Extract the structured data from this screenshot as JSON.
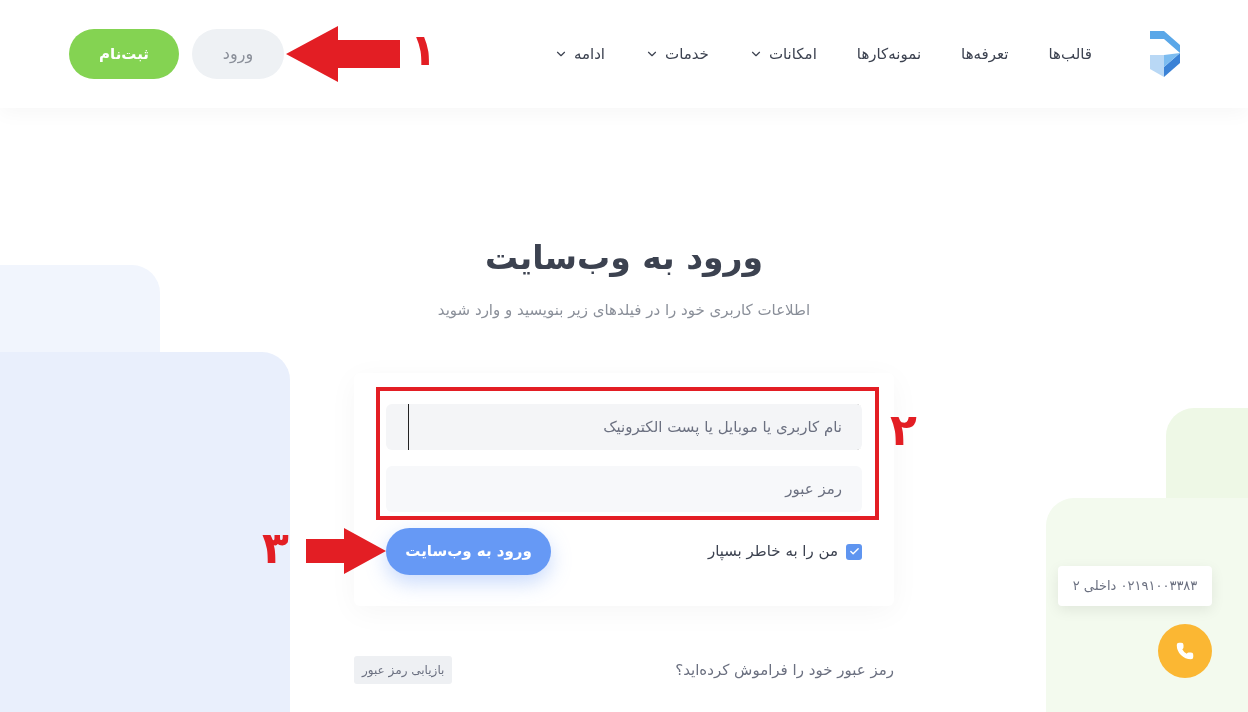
{
  "header": {
    "nav": [
      {
        "label": "قالب‌ها",
        "has_dropdown": false
      },
      {
        "label": "تعرفه‌ها",
        "has_dropdown": false
      },
      {
        "label": "نمونه‌کارها",
        "has_dropdown": false
      },
      {
        "label": "امکانات",
        "has_dropdown": true
      },
      {
        "label": "خدمات",
        "has_dropdown": true
      },
      {
        "label": "ادامه",
        "has_dropdown": true
      }
    ],
    "login_button": "ورود",
    "signup_button": "ثبت‌نام"
  },
  "title": "ورود به وب‌سایت",
  "subtitle": "اطلاعات کاربری خود را در فیلدهای زیر بنویسید و وارد شوید",
  "form": {
    "username": {
      "placeholder": "نام کاربری یا موبایل یا پست الکترونیک",
      "focused": true
    },
    "password": {
      "placeholder": "رمز عبور"
    },
    "remember": {
      "label": "من را به خاطر بسپار",
      "checked": true
    },
    "submit": "ورود به وب‌سایت"
  },
  "forgot": {
    "text": "رمز عبور خود را فراموش کرده‌اید؟",
    "link": "بازیابی رمز عبور"
  },
  "support": {
    "phone": "۰۲۱۹۱۰۰۳۳۸۳ داخلی ۲"
  },
  "annotations": [
    {
      "kind": "arrow-left",
      "number": "۱"
    },
    {
      "kind": "frame",
      "number": "۲"
    },
    {
      "kind": "arrow-right",
      "number": "۳"
    }
  ]
}
